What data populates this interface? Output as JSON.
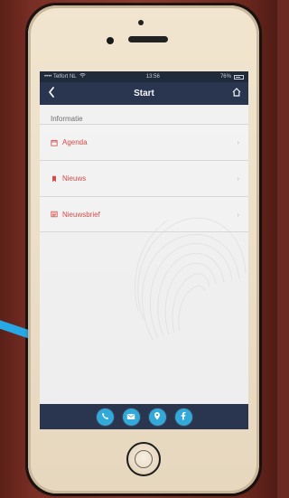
{
  "phone_screen": {
    "statusbar": {
      "left": "•••• Telfort NL",
      "wifi_icon": "wifi-icon",
      "time": "13:56",
      "right": "76%"
    },
    "navbar": {
      "title": "Start",
      "back_icon": "back-chevron-icon",
      "home_icon": "home-icon"
    },
    "section_title": "Informatie",
    "menu": {
      "items": [
        {
          "label": "Agenda",
          "icon": "calendar-icon"
        },
        {
          "label": "Nieuws",
          "icon": "bookmark-icon"
        },
        {
          "label": "Nieuwsbrief",
          "icon": "newsletter-icon"
        }
      ]
    },
    "bottom_actions": [
      {
        "icon": "phone-icon"
      },
      {
        "icon": "mail-icon"
      },
      {
        "icon": "location-icon"
      },
      {
        "icon": "facebook-icon"
      }
    ]
  },
  "colors": {
    "navbar": "#2a3650",
    "menu_text": "#d34b4b",
    "accent": "#32a9d8",
    "arrow": "#27a9e6"
  }
}
